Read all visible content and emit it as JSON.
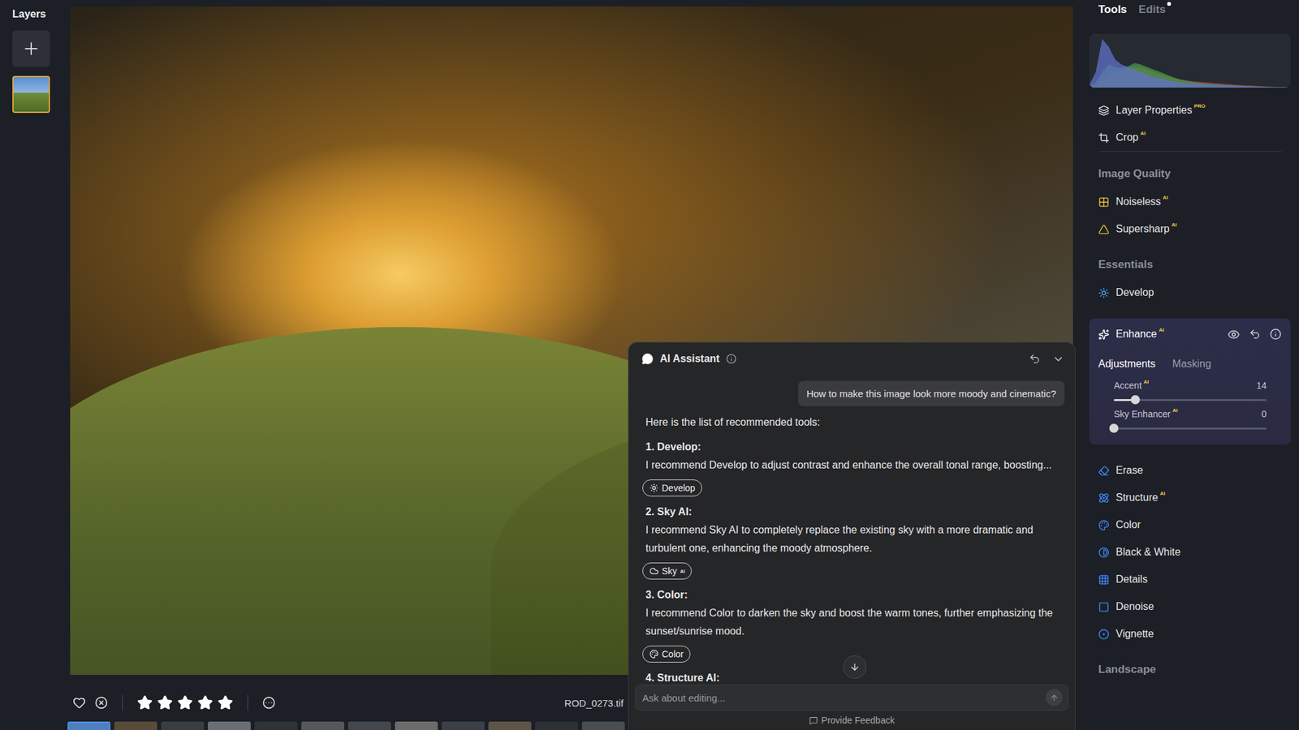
{
  "layers": {
    "title": "Layers",
    "items": [
      {
        "selected": true
      }
    ]
  },
  "bottom_bar": {
    "liked": false,
    "rating": {
      "stars": 5,
      "max": 5
    },
    "filename": "ROD_0273.tif"
  },
  "filmstrip": [
    {
      "selected": true
    },
    {
      "selected": false
    },
    {
      "selected": false
    },
    {
      "selected": false
    },
    {
      "selected": false
    },
    {
      "selected": false
    },
    {
      "selected": false
    },
    {
      "selected": false
    },
    {
      "selected": false
    },
    {
      "selected": false
    },
    {
      "selected": false
    },
    {
      "selected": false
    },
    {
      "selected": false
    }
  ],
  "tools_panel": {
    "tabs": [
      {
        "label": "Tools",
        "selected": true,
        "has_changes": false
      },
      {
        "label": "Edits",
        "selected": false,
        "has_changes": true
      }
    ],
    "histogram": {
      "series": [
        {
          "color": "#c0444a",
          "values": [
            1,
            5,
            15,
            25,
            30,
            32,
            38,
            42,
            40,
            36,
            30,
            26,
            22,
            19,
            16,
            14,
            12,
            11,
            10,
            9,
            8,
            7,
            6,
            5,
            4,
            4,
            3,
            2,
            2,
            1,
            1,
            0
          ]
        },
        {
          "color": "#3f9a4a",
          "values": [
            2,
            10,
            30,
            45,
            40,
            38,
            42,
            48,
            45,
            40,
            35,
            30,
            25,
            20,
            16,
            13,
            11,
            9,
            8,
            7,
            6,
            5,
            4,
            4,
            3,
            3,
            2,
            2,
            1,
            1,
            1,
            0
          ]
        },
        {
          "color": "#6270c8",
          "values": [
            5,
            30,
            95,
            80,
            55,
            45,
            40,
            35,
            30,
            25,
            20,
            18,
            15,
            12,
            10,
            9,
            8,
            7,
            6,
            5,
            5,
            4,
            4,
            3,
            3,
            2,
            2,
            2,
            1,
            1,
            1,
            0
          ]
        }
      ]
    },
    "items": [
      {
        "kind": "tool",
        "label": "Layer Properties",
        "badge": "PRO"
      },
      {
        "kind": "tool",
        "label": "Crop",
        "badge": "AI"
      },
      {
        "kind": "divider"
      },
      {
        "kind": "section",
        "label": "Image Quality"
      },
      {
        "kind": "tool",
        "label": "Noiseless",
        "badge": "AI"
      },
      {
        "kind": "tool",
        "label": "Supersharp",
        "badge": "AI"
      },
      {
        "kind": "section",
        "label": "Essentials"
      },
      {
        "kind": "tool",
        "label": "Develop",
        "badge": ""
      },
      {
        "kind": "panel",
        "label": "Enhance",
        "badge": "AI",
        "expanded": true,
        "tabs": [
          {
            "label": "Adjustments",
            "selected": true
          },
          {
            "label": "Masking",
            "selected": false
          }
        ],
        "sliders": [
          {
            "label": "Accent",
            "badge": "AI",
            "value": "14",
            "level": 0.14
          },
          {
            "label": "Sky Enhancer",
            "badge": "AI",
            "value": "0",
            "level": 0
          }
        ]
      },
      {
        "kind": "tool",
        "label": "Erase",
        "badge": ""
      },
      {
        "kind": "tool",
        "label": "Structure",
        "badge": "AI"
      },
      {
        "kind": "tool",
        "label": "Color",
        "badge": ""
      },
      {
        "kind": "tool",
        "label": "Black & White",
        "badge": ""
      },
      {
        "kind": "tool",
        "label": "Details",
        "badge": ""
      },
      {
        "kind": "tool",
        "label": "Denoise",
        "badge": ""
      },
      {
        "kind": "tool",
        "label": "Vignette",
        "badge": ""
      },
      {
        "kind": "section",
        "label": "Landscape"
      }
    ]
  },
  "assistant": {
    "title": "AI Assistant",
    "user_message": "How to make this image look more moody and cinematic?",
    "intro": "Here is the list of recommended tools:",
    "items": [
      {
        "number": "1.",
        "title": "Develop:",
        "text": "I recommend Develop to adjust contrast and enhance the overall tonal range, boosting...",
        "chip": {
          "label": "Develop",
          "badge": ""
        }
      },
      {
        "number": "2.",
        "title": "Sky AI:",
        "text": "I recommend Sky AI to completely replace the existing sky with a more dramatic and turbulent one, enhancing the moody atmosphere.",
        "chip": {
          "label": "Sky",
          "badge": "AI"
        }
      },
      {
        "number": "3.",
        "title": "Color:",
        "text": "I recommend Color to darken the sky and boost the warm tones, further emphasizing the sunset/sunrise mood.",
        "chip": {
          "label": "Color",
          "badge": ""
        }
      },
      {
        "number": "4.",
        "title": "Structure AI:",
        "text": "",
        "chip": null
      }
    ],
    "input_placeholder": "Ask about editing...",
    "feedback": "Provide Feedback"
  }
}
